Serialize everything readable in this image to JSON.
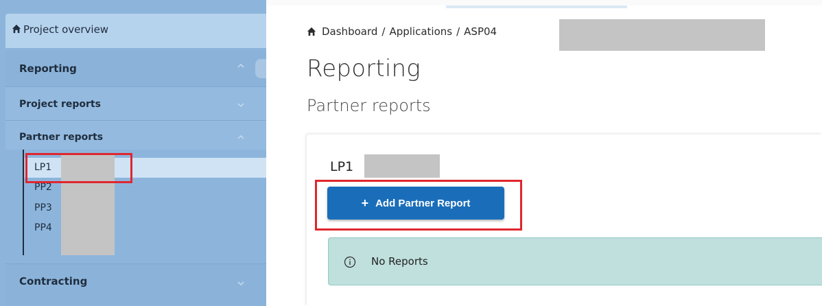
{
  "sidebar": {
    "project_overview": "Project overview",
    "reporting": "Reporting",
    "project_reports": "Project reports",
    "partner_reports": "Partner reports",
    "partners": [
      "LP1",
      "PP2",
      "PP3",
      "PP4"
    ],
    "contracting": "Contracting"
  },
  "breadcrumb": {
    "items": [
      "Dashboard",
      "Applications",
      "ASP04"
    ],
    "separator": "/"
  },
  "page": {
    "title": "Reporting",
    "subtitle": "Partner reports"
  },
  "card": {
    "title": "LP1",
    "add_button": "Add Partner Report",
    "add_icon": "+",
    "alert_text": "No Reports"
  },
  "colors": {
    "sidebar": "#8db5dc",
    "primary_button": "#1a6eb9",
    "info_alert": "#bfe0dd",
    "highlight": "#e0262e"
  }
}
